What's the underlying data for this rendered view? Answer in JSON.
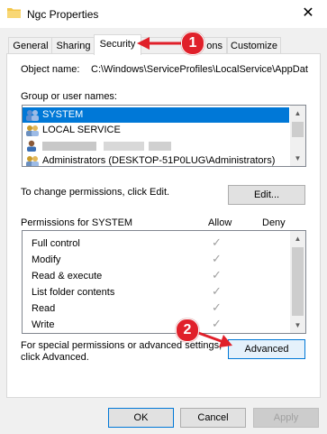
{
  "window": {
    "title": "Ngc Properties",
    "close_glyph": "✕"
  },
  "tabs": [
    {
      "label": "General"
    },
    {
      "label": "Sharing"
    },
    {
      "label": "Security"
    },
    {
      "label": "ons"
    },
    {
      "label": "Customize"
    }
  ],
  "object": {
    "label": "Object name:",
    "value": "C:\\Windows\\ServiceProfiles\\LocalService\\AppDat"
  },
  "groups": {
    "label": "Group or user names:",
    "items": [
      {
        "label": "SYSTEM",
        "icon": "users-icon"
      },
      {
        "label": "LOCAL SERVICE",
        "icon": "users-icon"
      },
      {
        "label": "",
        "icon": "user-icon"
      },
      {
        "label": "Administrators (DESKTOP-51P0LUG\\Administrators)",
        "icon": "users-icon"
      }
    ]
  },
  "change_text": "To change permissions, click Edit.",
  "edit_label": "Edit...",
  "permissions": {
    "label": "Permissions for SYSTEM",
    "allow_header": "Allow",
    "deny_header": "Deny",
    "check_glyph": "✓",
    "items": [
      {
        "label": "Full control"
      },
      {
        "label": "Modify"
      },
      {
        "label": "Read & execute"
      },
      {
        "label": "List folder contents"
      },
      {
        "label": "Read"
      },
      {
        "label": "Write"
      }
    ]
  },
  "advanced": {
    "line1": "For special permissions or advanced settings,",
    "line2": "click Advanced.",
    "label": "Advanced"
  },
  "footer": {
    "ok": "OK",
    "cancel": "Cancel",
    "apply": "Apply"
  },
  "annotations": {
    "one": "1",
    "two": "2",
    "color": "#e0202a"
  }
}
